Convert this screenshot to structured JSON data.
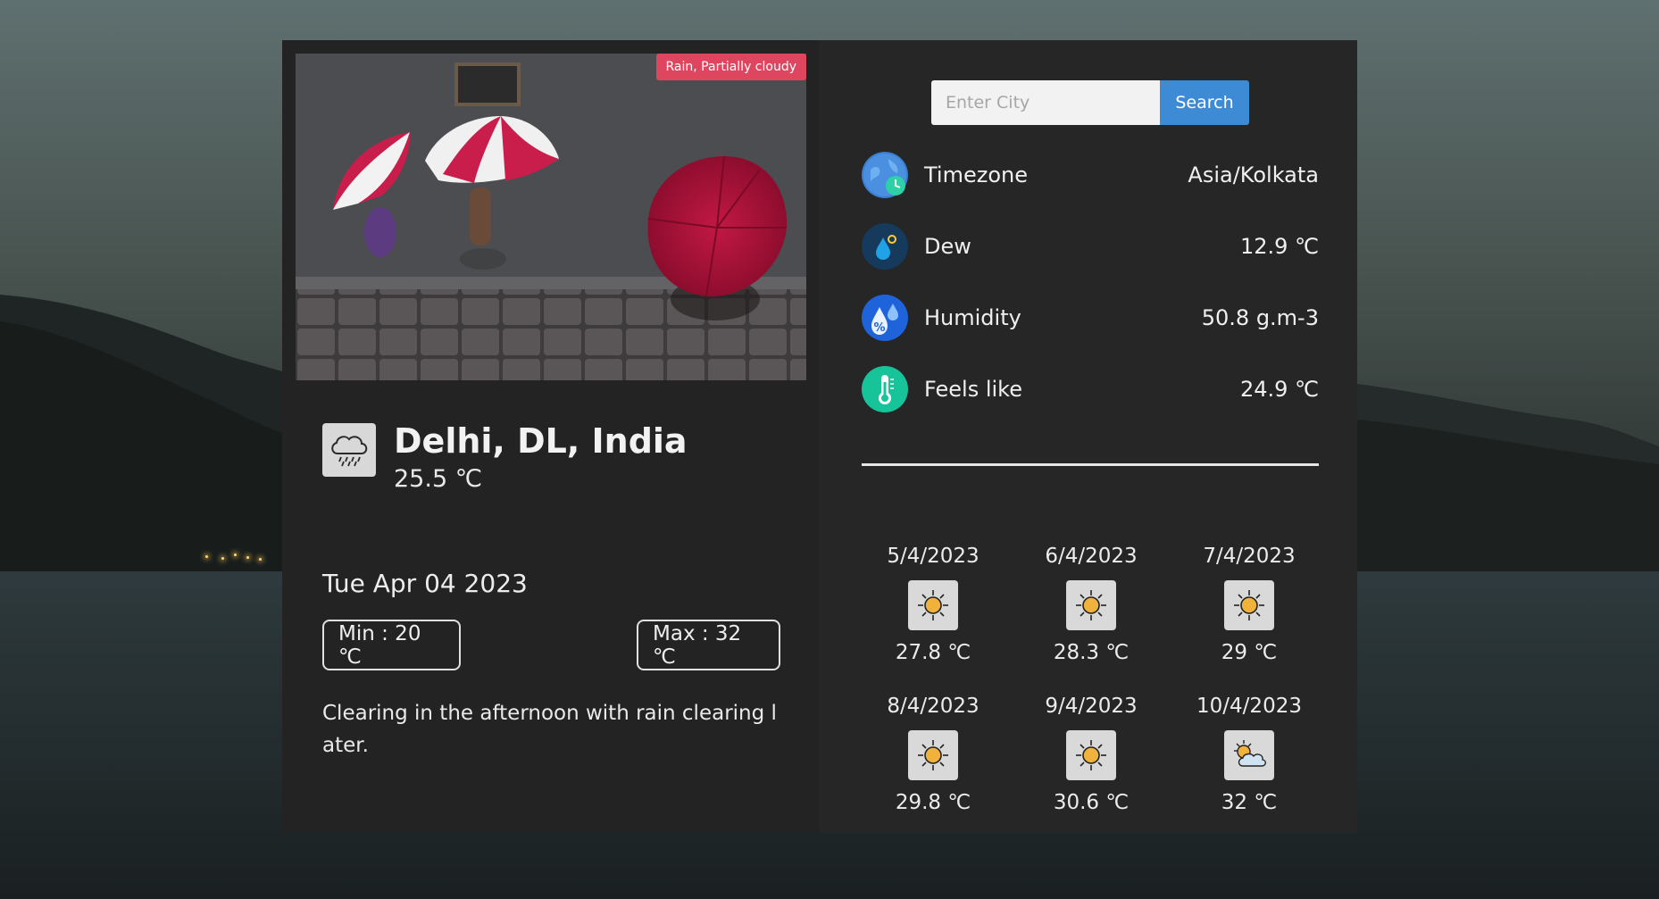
{
  "condition_badge": "Rain, Partially cloudy",
  "location": {
    "city": "Delhi, DL, India",
    "temperature": "25.5 ℃",
    "date": "Tue Apr 04 2023",
    "min": "Min : 20 ℃",
    "max": "Max : 32 ℃",
    "description": "Clearing in the afternoon with rain clearing later.",
    "condition_icon": "rain-cloud-icon"
  },
  "search": {
    "placeholder": "Enter City",
    "button_label": "Search"
  },
  "details": [
    {
      "label": "Timezone",
      "value": "Asia/Kolkata",
      "icon": "globe-clock-icon"
    },
    {
      "label": "Dew",
      "value": "12.9 ℃",
      "icon": "dew-drop-icon"
    },
    {
      "label": "Humidity",
      "value": "50.8 g.m-3",
      "icon": "humidity-icon"
    },
    {
      "label": "Feels like",
      "value": "24.9 ℃",
      "icon": "thermometer-icon"
    }
  ],
  "forecast": [
    {
      "date": "5/4/2023",
      "temp": "27.8 ℃",
      "icon": "sun-icon"
    },
    {
      "date": "6/4/2023",
      "temp": "28.3 ℃",
      "icon": "sun-icon"
    },
    {
      "date": "7/4/2023",
      "temp": "29 ℃",
      "icon": "sun-icon"
    },
    {
      "date": "8/4/2023",
      "temp": "29.8 ℃",
      "icon": "sun-icon"
    },
    {
      "date": "9/4/2023",
      "temp": "30.6 ℃",
      "icon": "sun-icon"
    },
    {
      "date": "10/4/2023",
      "temp": "32 ℃",
      "icon": "partly-cloudy-icon"
    }
  ],
  "colors": {
    "badge": "#de4660",
    "search_button": "#3d8bd4",
    "panel": "#242424"
  }
}
